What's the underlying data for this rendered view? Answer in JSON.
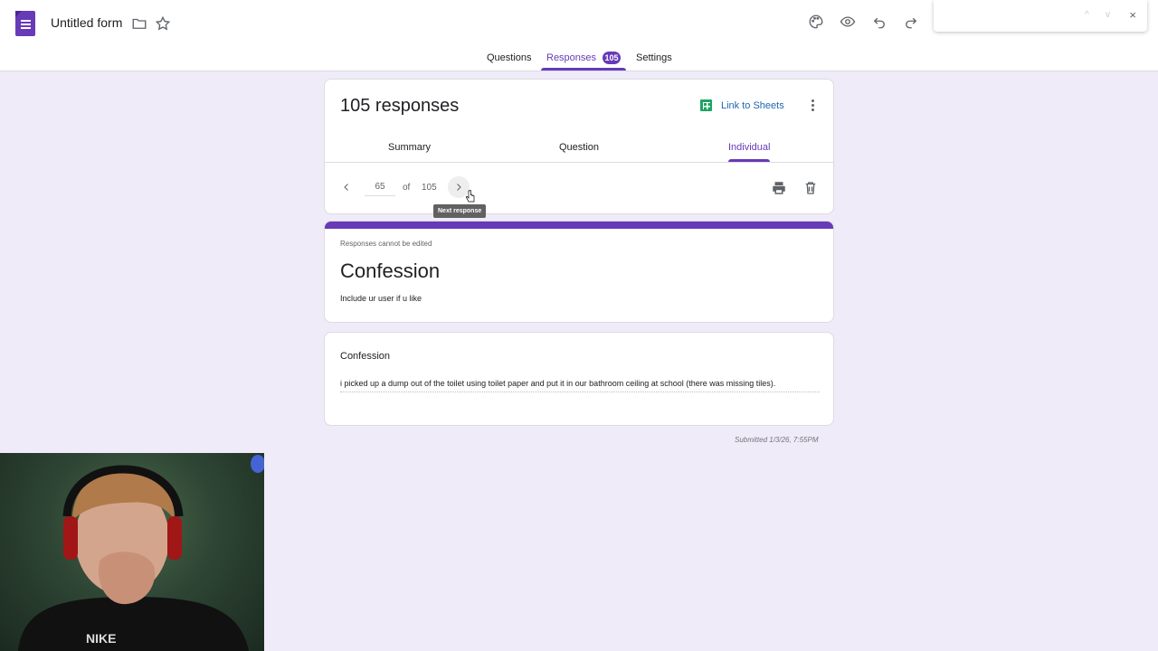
{
  "header": {
    "doc_title": "Untitled form",
    "icons": [
      "folder-icon",
      "star-icon",
      "palette-icon",
      "eye-icon",
      "undo-icon",
      "redo-icon"
    ]
  },
  "tabs": [
    {
      "label": "Questions"
    },
    {
      "label": "Responses",
      "badge": "105"
    },
    {
      "label": "Settings"
    }
  ],
  "find_panel": {
    "up": "^",
    "down": "v",
    "close": "×"
  },
  "responses": {
    "count_title": "105 responses",
    "link_sheets": "Link to Sheets",
    "subtabs": [
      "Summary",
      "Question",
      "Individual"
    ],
    "current": "65",
    "of": "of",
    "total": "105",
    "tooltip": "Next response"
  },
  "form": {
    "notice": "Responses cannot be edited",
    "title": "Confession",
    "description": "Include ur user if u like"
  },
  "question": {
    "title": "Confession",
    "answer": "i picked up a dump out of the toilet using toilet paper and put it in our bathroom ceiling at school (there was missing tiles)."
  },
  "submitted": "Submitted 1/3/26, 7:55PM",
  "colors": {
    "accent": "#673ab7",
    "background": "#f0ebf8",
    "link": "#1e66b2",
    "sheets_green": "#1fa463"
  }
}
